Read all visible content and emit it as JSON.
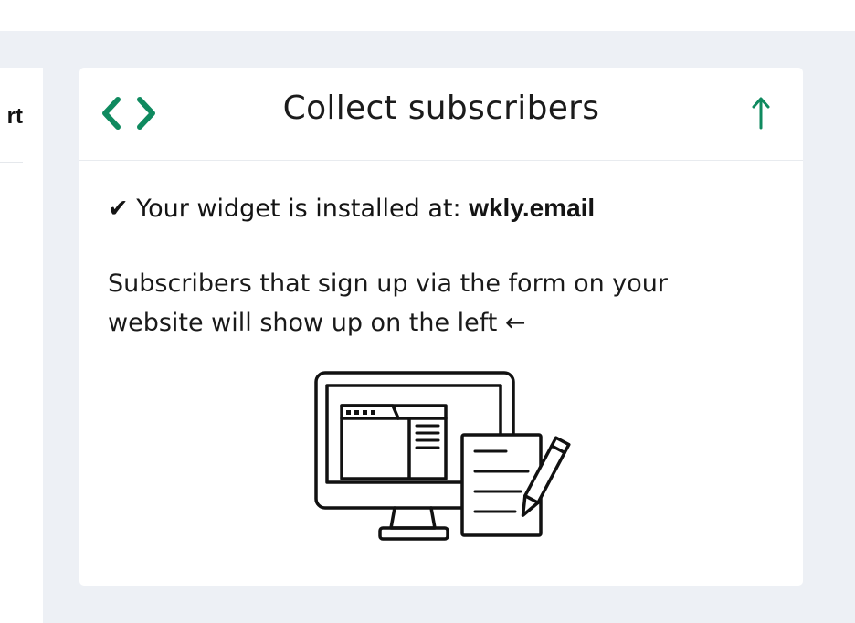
{
  "left_panel": {
    "partial_heading": "rt"
  },
  "card": {
    "title": "Collect subscribers",
    "code_toggle_icon": "code-brackets-icon",
    "collapse_icon": "arrow-up-icon",
    "status_check": "✔",
    "status_prefix": "Your widget is installed at:",
    "installed_domain": "wkly.email",
    "info_text": "Subscribers that sign up via the form on your website will show up on the left ←",
    "illustration": "computer-with-document-icon"
  },
  "colors": {
    "accent_green": "#0f8a5f",
    "background": "#edf0f5",
    "card": "#ffffff",
    "text": "#141414"
  }
}
